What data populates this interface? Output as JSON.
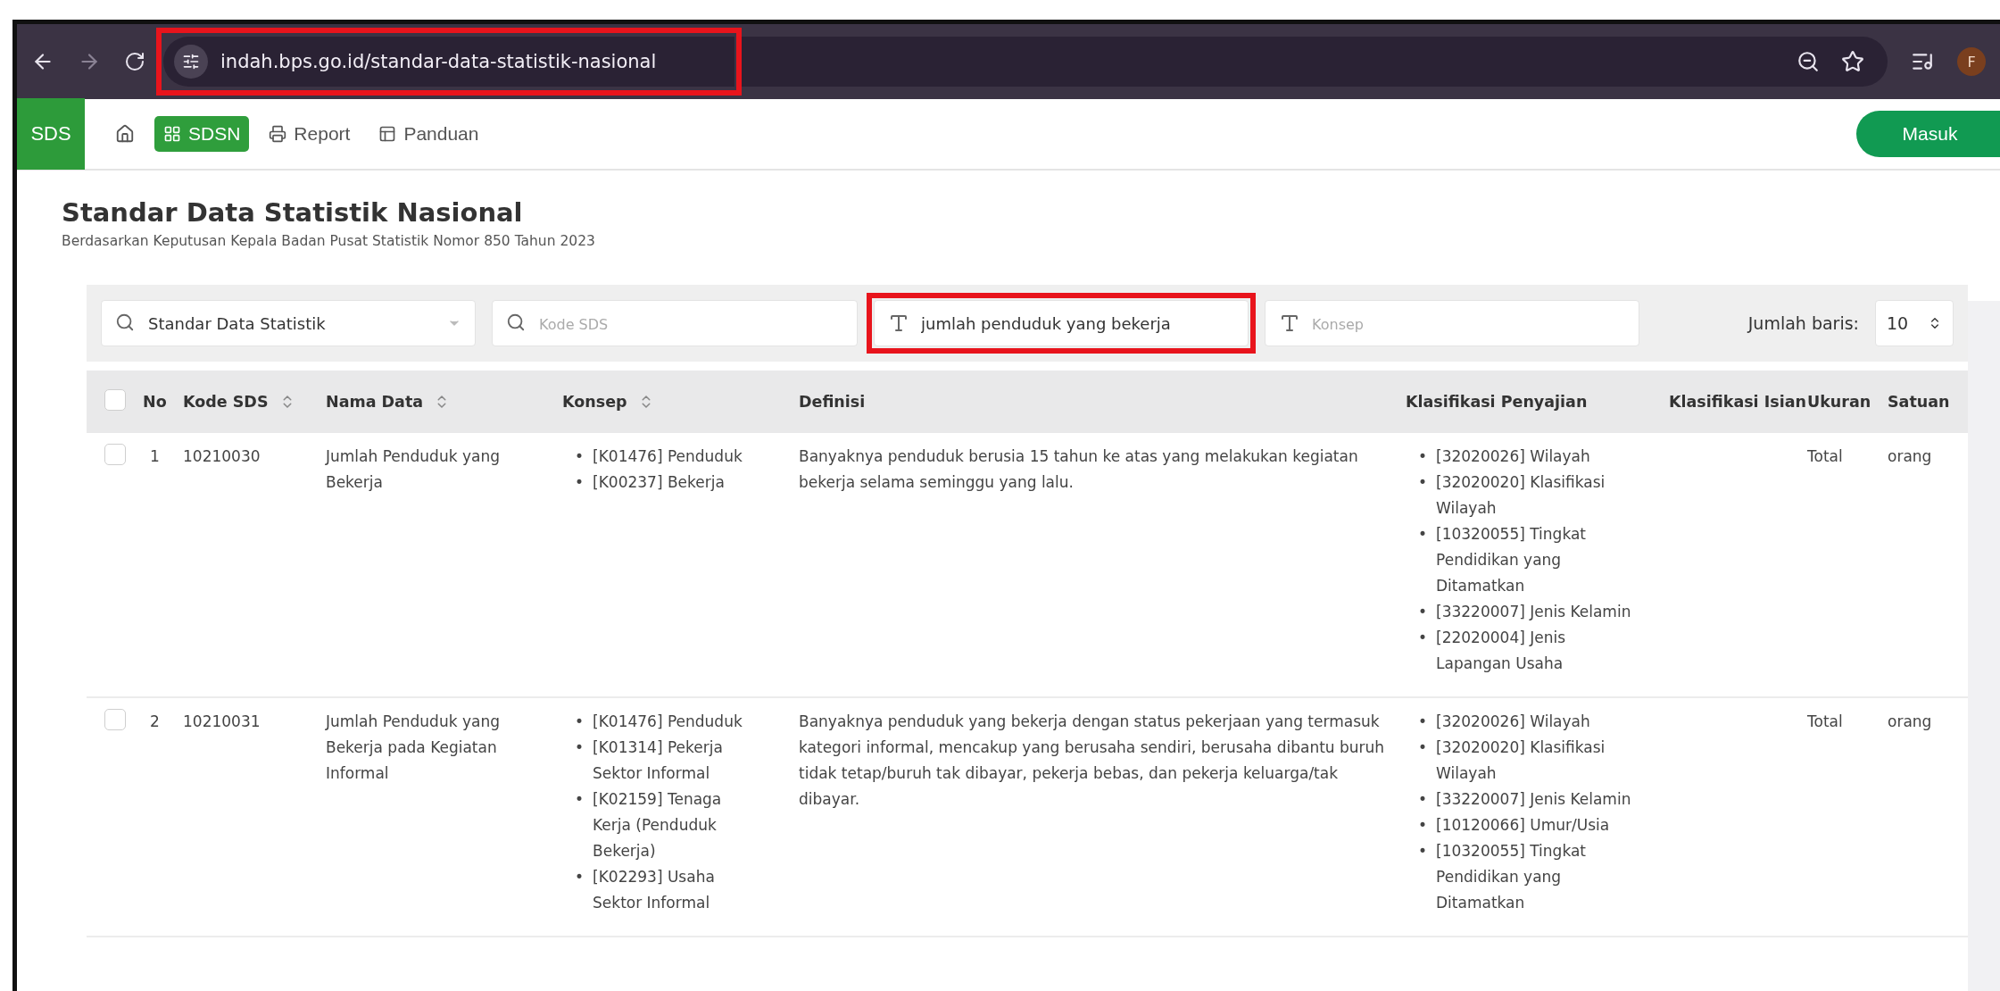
{
  "browser": {
    "address": "indah.bps.go.id/standar-data-statistik-nasional",
    "highlighted": true,
    "avatar": "F"
  },
  "nav": {
    "brand": "SDS",
    "items": [
      {
        "kind": "home",
        "selected": false
      },
      {
        "kind": "grid",
        "label": "SDSN",
        "selected": true
      },
      {
        "kind": "print",
        "label": "Report",
        "selected": false
      },
      {
        "kind": "guide",
        "label": "Panduan",
        "selected": false
      }
    ],
    "login": "Masuk"
  },
  "page": {
    "title": "Standar Data Statistik Nasional",
    "subtitle": "Berdasarkan Keputusan Kepala Badan Pusat Statistik Nomor 850 Tahun 2023"
  },
  "filters": [
    {
      "kind": "dropdown",
      "value": "Standar Data Statistik",
      "highlighted": false
    },
    {
      "kind": "search",
      "placeholder": "Kode SDS",
      "highlighted": false
    },
    {
      "kind": "text",
      "value": "jumlah penduduk yang bekerja",
      "highlighted": true
    },
    {
      "kind": "text",
      "placeholder": "Konsep",
      "highlighted": false
    }
  ],
  "rows_per_page": {
    "label": "Jumlah baris:",
    "value": "10"
  },
  "table": {
    "all_checked": false,
    "bullet": "•",
    "columns": [
      {
        "label": "No",
        "sortable": false
      },
      {
        "label": "Kode SDS",
        "sortable": true
      },
      {
        "label": "Nama Data",
        "sortable": true
      },
      {
        "label": "Konsep",
        "sortable": true
      },
      {
        "label": "Definisi",
        "sortable": false
      },
      {
        "label": "Klasifikasi Penyajian",
        "sortable": false
      },
      {
        "label": "Klasifikasi Isian",
        "sortable": false
      },
      {
        "label": "Ukuran",
        "sortable": false
      },
      {
        "label": "Satuan",
        "sortable": false
      }
    ],
    "rows": [
      {
        "checked": false,
        "no": "1",
        "kode": "10210030",
        "nama": "Jumlah Penduduk yang Bekerja",
        "konsep": [
          "[K01476] Penduduk",
          "[K00237] Bekerja"
        ],
        "definisi": "Banyaknya penduduk berusia 15 tahun ke atas yang melakukan kegiatan bekerja selama seminggu yang lalu.",
        "klasifikasi": [
          "[32020026] Wilayah",
          "[32020020] Klasifikasi Wilayah",
          "[10320055] Tingkat Pendidikan yang Ditamatkan",
          "[33220007] Jenis Kelamin",
          "[22020004] Jenis Lapangan Usaha"
        ],
        "ukuran": "Total",
        "satuan": "orang"
      },
      {
        "checked": false,
        "no": "2",
        "kode": "10210031",
        "nama": "Jumlah Penduduk yang Bekerja pada Kegiatan Informal",
        "konsep": [
          "[K01476] Penduduk",
          "[K01314] Pekerja Sektor Informal",
          "[K02159] Tenaga Kerja (Penduduk Bekerja)",
          "[K02293] Usaha Sektor Informal"
        ],
        "definisi": "Banyaknya penduduk yang bekerja dengan status pekerjaan yang termasuk kategori informal, mencakup yang berusaha sendiri, berusaha dibantu buruh tidak tetap/buruh tak dibayar, pekerja bebas, dan pekerja keluarga/tak dibayar.",
        "klasifikasi": [
          "[32020026] Wilayah",
          "[32020020] Klasifikasi Wilayah",
          "[33220007] Jenis Kelamin",
          "[10120066] Umur/Usia",
          "[10320055] Tingkat Pendidikan yang Ditamatkan"
        ],
        "ukuran": "Total",
        "satuan": "orang"
      }
    ]
  }
}
